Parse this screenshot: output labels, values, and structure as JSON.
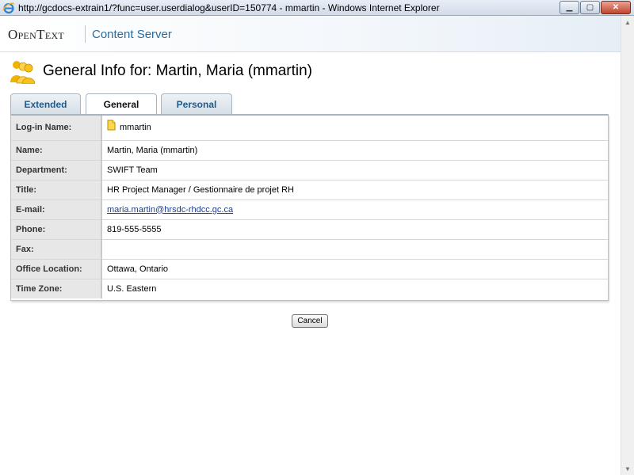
{
  "window": {
    "title": "http://gcdocs-extrain1/?func=user.userdialog&userID=150774 - mmartin - Windows Internet Explorer"
  },
  "header": {
    "logo_text": "OpenText",
    "product_name": "Content Server"
  },
  "page": {
    "title": "General Info for: Martin, Maria (mmartin)"
  },
  "tabs": [
    {
      "label": "Extended",
      "active": false
    },
    {
      "label": "General",
      "active": true
    },
    {
      "label": "Personal",
      "active": false
    }
  ],
  "info": {
    "login_label": "Log-in Name:",
    "login_value": "mmartin",
    "name_label": "Name:",
    "name_value": "Martin, Maria (mmartin)",
    "department_label": "Department:",
    "department_value": "SWIFT Team",
    "title_label": "Title:",
    "title_value": "HR Project Manager / Gestionnaire de projet RH",
    "email_label": "E-mail:",
    "email_value": "maria.martin@hrsdc-rhdcc.gc.ca",
    "phone_label": "Phone:",
    "phone_value": "819-555-5555",
    "fax_label": "Fax:",
    "fax_value": "",
    "office_label": "Office Location:",
    "office_value": "Ottawa, Ontario",
    "timezone_label": "Time Zone:",
    "timezone_value": "U.S. Eastern"
  },
  "actions": {
    "cancel_label": "Cancel"
  },
  "colors": {
    "product_blue": "#2b6b9e",
    "tab_text_blue": "#1f5a8a",
    "label_bg": "#e7e7e7"
  },
  "icons": {
    "browser": "ie-icon",
    "page": "users-group-icon",
    "login": "user-icon"
  }
}
